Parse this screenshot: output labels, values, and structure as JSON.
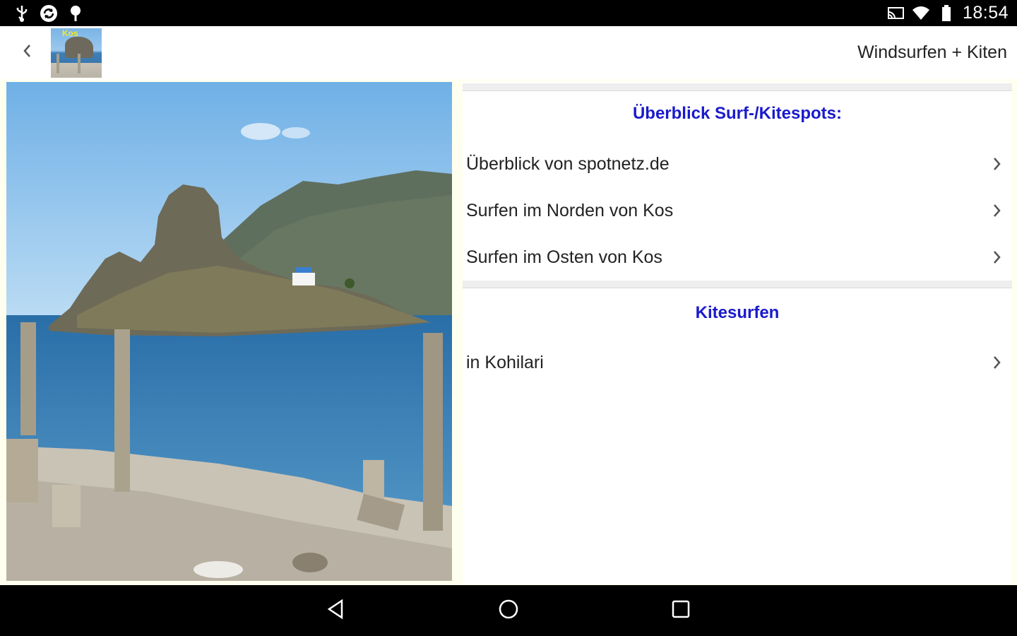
{
  "status_bar": {
    "time": "18:54",
    "left_icons": [
      "usb-icon",
      "sync-icon",
      "location-pin-icon"
    ],
    "right_icons": [
      "cast-icon",
      "wifi-icon",
      "battery-icon"
    ]
  },
  "app_bar": {
    "title": "Windsurfen + Kiten",
    "thumbnail_text": "Kos",
    "back_icon": "chevron-left-icon"
  },
  "panel": {
    "sections": [
      {
        "title": "Überblick Surf-/Kitespots:",
        "items": [
          {
            "label": "Überblick von spotnetz.de"
          },
          {
            "label": "Surfen im Norden von Kos"
          },
          {
            "label": "Surfen im Osten von Kos"
          }
        ]
      },
      {
        "title": "Kitesurfen",
        "items": [
          {
            "label": "in Kohilari"
          }
        ]
      }
    ],
    "title_color": "#1a1acc"
  },
  "nav_bar": {
    "buttons": [
      "back-triangle-icon",
      "home-circle-icon",
      "recents-square-icon"
    ]
  }
}
